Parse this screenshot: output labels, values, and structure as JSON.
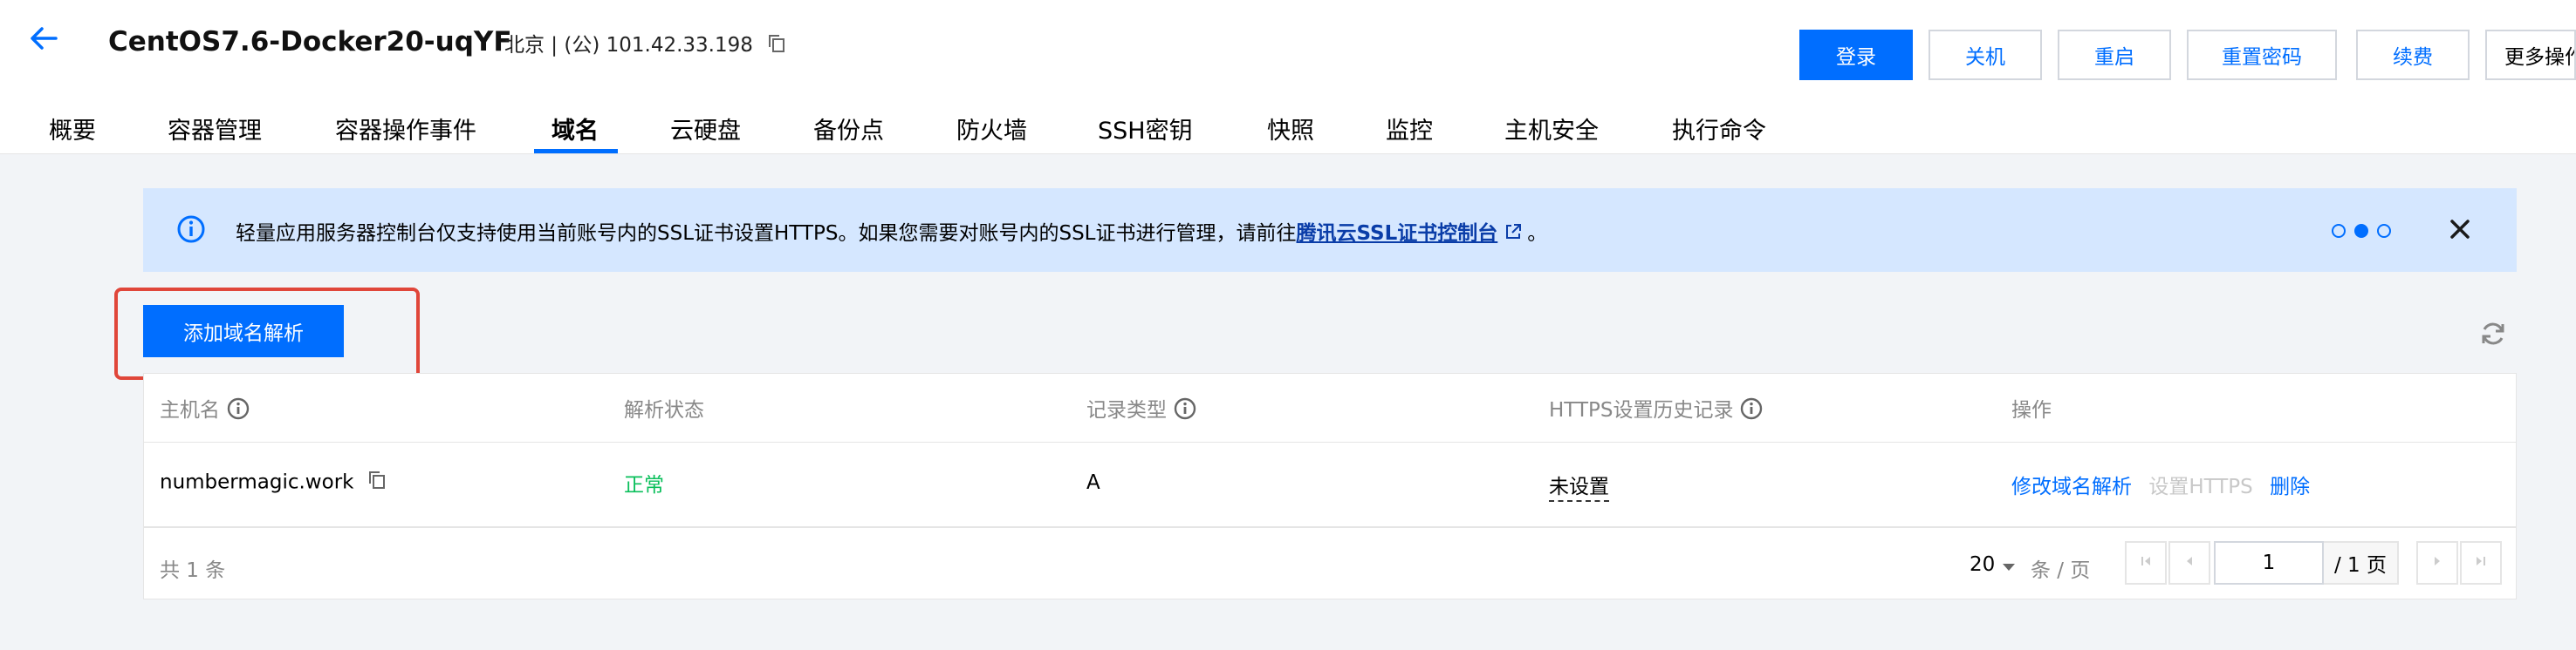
{
  "header": {
    "title": "CentOS7.6-Docker20-uqYF",
    "region": "北京 | (公) 101.42.33.198",
    "buttons": {
      "login": "登录",
      "shutdown": "关机",
      "restart": "重启",
      "reset_password": "重置密码",
      "renew": "续费",
      "more": "更多操作"
    }
  },
  "tabs": [
    {
      "label": "概要"
    },
    {
      "label": "容器管理"
    },
    {
      "label": "容器操作事件"
    },
    {
      "label": "域名",
      "active": true
    },
    {
      "label": "云硬盘"
    },
    {
      "label": "备份点"
    },
    {
      "label": "防火墙"
    },
    {
      "label": "SSH密钥"
    },
    {
      "label": "快照"
    },
    {
      "label": "监控"
    },
    {
      "label": "主机安全"
    },
    {
      "label": "执行命令"
    }
  ],
  "notice": {
    "text": "轻量应用服务器控制台仅支持使用当前账号内的SSL证书设置HTTPS。如果您需要对账号内的SSL证书进行管理，请前往",
    "link": "腾讯云SSL证书控制台",
    "suffix": "。",
    "carousel": {
      "total": 3,
      "active": 2
    }
  },
  "actions": {
    "add_label": "添加域名解析"
  },
  "table": {
    "columns": {
      "host": "主机名",
      "status": "解析状态",
      "record_type": "记录类型",
      "https_history": "HTTPS设置历史记录",
      "operations": "操作"
    },
    "rows": [
      {
        "host": "numbermagic.work",
        "status": "正常",
        "record_type": "A",
        "https_history": "未设置",
        "ops": {
          "edit": "修改域名解析",
          "https": "设置HTTPS",
          "delete": "删除"
        }
      }
    ]
  },
  "pagination": {
    "total_label": "共 1 条",
    "page_size": "20",
    "page_size_unit": "条 / 页",
    "current_page": "1",
    "total_pages": "/ 1 页"
  },
  "colors": {
    "primary": "#006eff",
    "notice_bg": "#d5e7ff",
    "status_ok": "#0abf5b",
    "highlight": "#e0463a"
  }
}
